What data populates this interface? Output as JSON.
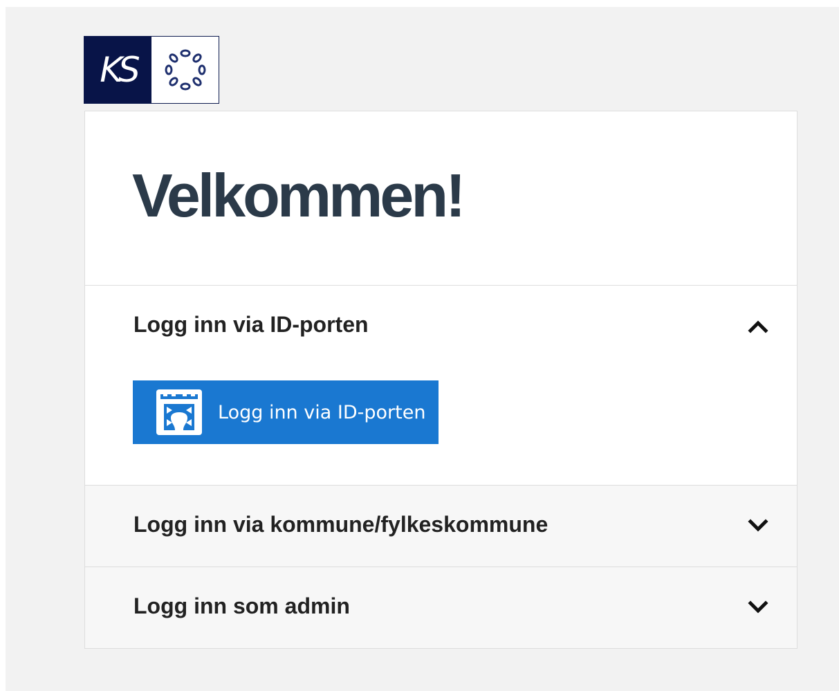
{
  "colors": {
    "page_background": "#f2f2f2",
    "logo_navy": "#081448",
    "title_text": "#2b3a49",
    "primary_button": "#1a78d1",
    "collapsed_section": "#f7f7f7"
  },
  "logo": {
    "text": "KS",
    "emblem_icon": "chain-ring-emblem"
  },
  "card": {
    "title": "Velkommen!"
  },
  "sections": [
    {
      "title": "Logg inn via ID-porten",
      "expanded": true,
      "chevron_icon": "chevron-up-icon",
      "button": {
        "label": "Logg inn via ID-porten",
        "icon": "id-porten-icon"
      }
    },
    {
      "title": "Logg inn via kommune/fylkeskommune",
      "expanded": false,
      "chevron_icon": "chevron-down-icon"
    },
    {
      "title": "Logg inn som admin",
      "expanded": false,
      "chevron_icon": "chevron-down-icon"
    }
  ]
}
